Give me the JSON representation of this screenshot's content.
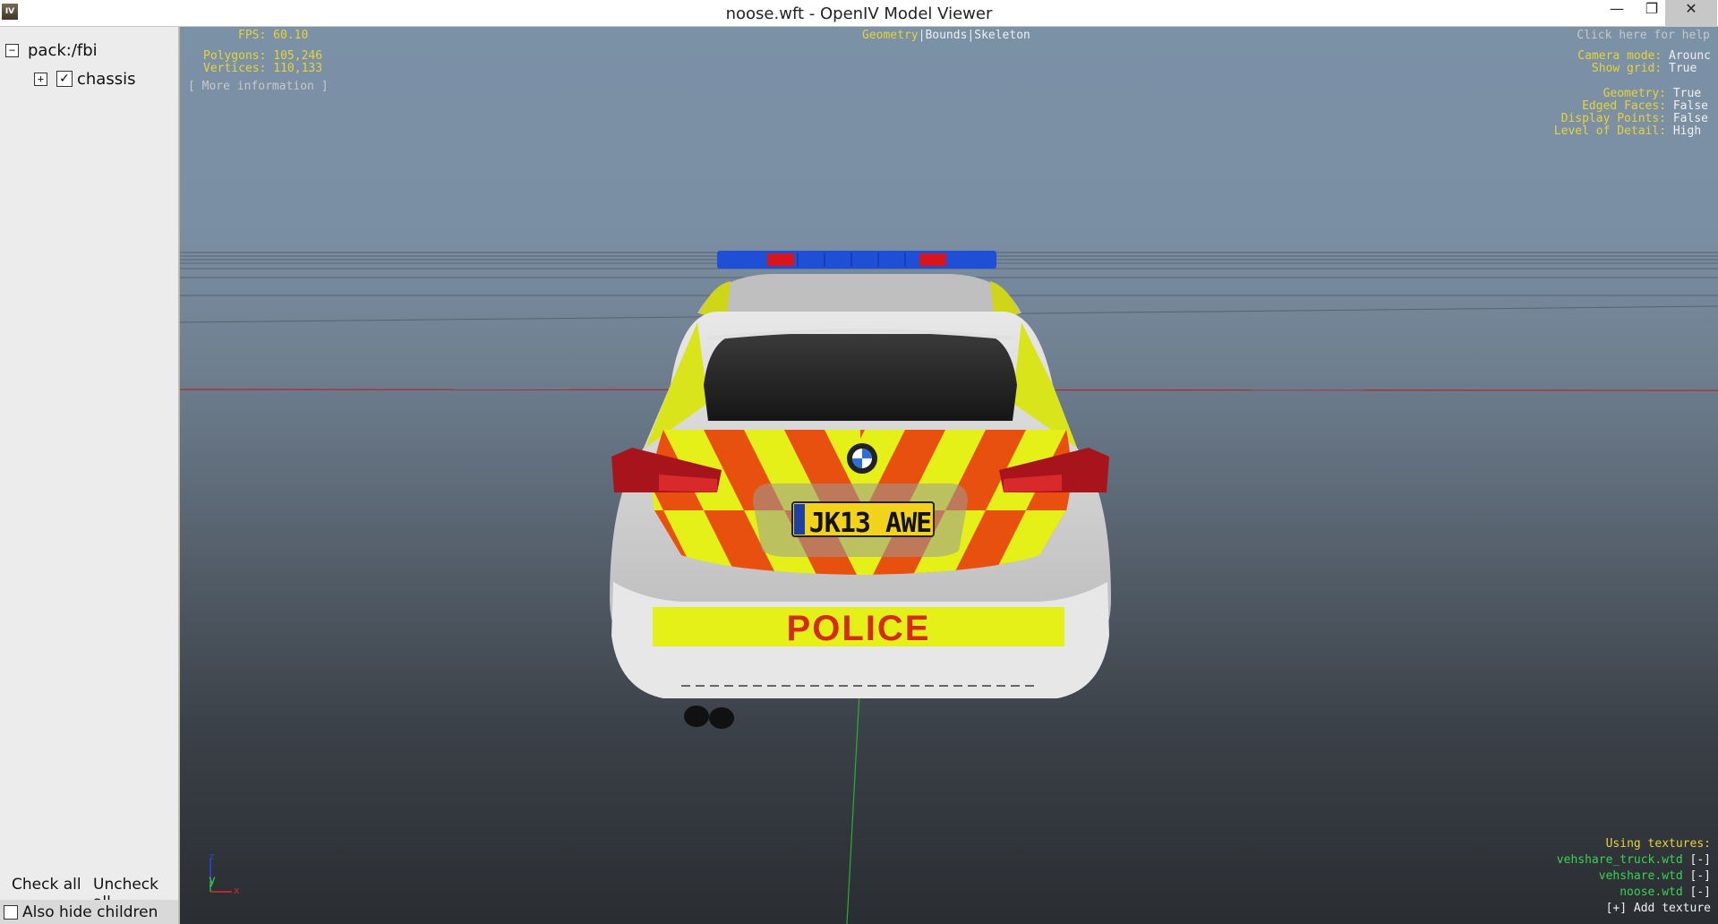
{
  "window": {
    "app_icon_text": "IV",
    "title": "noose.wft - OpenIV Model Viewer",
    "minimize_glyph": "—",
    "maximize_glyph": "❐",
    "close_glyph": "✕"
  },
  "tree": {
    "root": {
      "expander": "−",
      "label": "pack:/fbi"
    },
    "child": {
      "expander": "+",
      "check": "✓",
      "label": "chassis",
      "checked": true
    }
  },
  "bottom_panel": {
    "check_all": "Check all",
    "uncheck_all": "Uncheck all",
    "also_hide_children": "Also hide children",
    "also_hide_children_checked": false
  },
  "hud": {
    "fps_label": "FPS:",
    "fps_value": "60.10",
    "polygons_label": "Polygons:",
    "polygons_value": "105,246",
    "vertices_label": "Vertices:",
    "vertices_value": "110,133",
    "more_info": "[ More information ]",
    "mode_geometry": "Geometry",
    "mode_sep1": "|",
    "mode_bounds": "Bounds",
    "mode_sep2": "|",
    "mode_skeleton": "Skeleton",
    "help": "Click here for help",
    "camera_mode_label": "Camera mode:",
    "camera_mode_value": "Arounc",
    "show_grid_label": "Show grid:",
    "show_grid_value": "True",
    "geometry_label": "Geometry:",
    "geometry_value": "True",
    "edged_faces_label": "Edged Faces:",
    "edged_faces_value": "False",
    "display_points_label": "Display Points:",
    "display_points_value": "False",
    "lod_label": "Level of Detail:",
    "lod_value": "High",
    "textures_title": "Using textures:",
    "textures": [
      {
        "name": "vehshare_truck.wtd",
        "action": "[-]"
      },
      {
        "name": "vehshare.wtd",
        "action": "[-]"
      },
      {
        "name": "noose.wtd",
        "action": "[-]"
      }
    ],
    "add_texture": "[+] Add texture"
  },
  "model": {
    "plate": "JK13 AWE",
    "rear_text": "POLICE"
  },
  "gizmo": {
    "y_label": "y",
    "x_label": "x",
    "z_label": "z"
  },
  "colors": {
    "hud_yellow": "#e8d23a",
    "hud_green": "#39d353",
    "livery_yellow": "#e4f018",
    "livery_orange": "#e8500f",
    "light_bar_blue": "#1f4fd6",
    "light_bar_red": "#d8141c"
  }
}
